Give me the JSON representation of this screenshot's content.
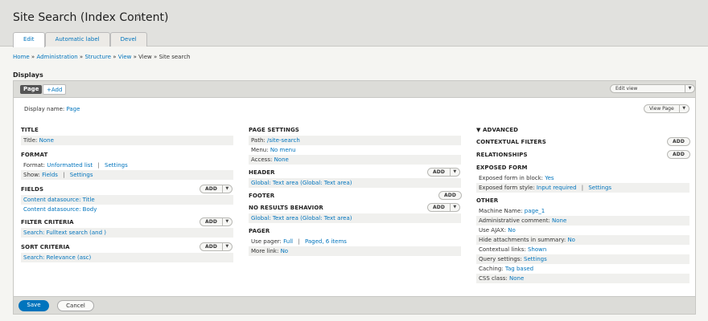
{
  "header": {
    "title": "Site Search (Index Content)",
    "star": "☆",
    "tabs": [
      "Edit",
      "Automatic label",
      "Devel"
    ]
  },
  "breadcrumb": {
    "home": "Home",
    "administration": "Administration",
    "structure": "Structure",
    "view": "View",
    "view_plain": "View",
    "current": "Site search",
    "sep": "»"
  },
  "displays": {
    "label": "Displays",
    "page_button": "Page",
    "add_button": "+Add",
    "edit_view_name": "Edit view name/description",
    "display_name_label": "Display name:",
    "display_name_value": "Page",
    "view_page": "View Page"
  },
  "col1": {
    "title_h": "TITLE",
    "title_label": "Title:",
    "title_value": "None",
    "format_h": "FORMAT",
    "format_label": "Format:",
    "format_value": "Unformatted list",
    "format_settings": "Settings",
    "show_label": "Show:",
    "show_value": "Fields",
    "show_settings": "Settings",
    "fields_h": "FIELDS",
    "fields": [
      "Content datasource: Title",
      "Content datasource: Body"
    ],
    "filter_h": "FILTER CRITERIA",
    "filter": "Search: Fulltext search (and )",
    "sort_h": "SORT CRITERIA",
    "sort": "Search: Relevance (asc)",
    "add": "Add"
  },
  "col2": {
    "page_settings_h": "PAGE SETTINGS",
    "path_label": "Path:",
    "path_value": "/site-search",
    "menu_label": "Menu:",
    "menu_value": "No menu",
    "access_label": "Access:",
    "access_value": "None",
    "header_h": "HEADER",
    "header_value": "Global: Text area (Global: Text area)",
    "footer_h": "FOOTER",
    "noresults_h": "NO RESULTS BEHAVIOR",
    "noresults_value": "Global: Text area (Global: Text area)",
    "pager_h": "PAGER",
    "use_pager_label": "Use pager:",
    "use_pager_value": "Full",
    "use_pager_paged": "Paged, 6 items",
    "more_link_label": "More link:",
    "more_link_value": "No",
    "add": "Add"
  },
  "col3": {
    "advanced_h": "▼ ADVANCED",
    "contextual_h": "CONTEXTUAL FILTERS",
    "relationships_h": "RELATIONSHIPS",
    "exposed_h": "EXPOSED FORM",
    "exposed_block_label": "Exposed form in block:",
    "exposed_block_value": "Yes",
    "exposed_style_label": "Exposed form style:",
    "exposed_style_value": "Input required",
    "exposed_style_settings": "Settings",
    "other_h": "OTHER",
    "machine_label": "Machine Name:",
    "machine_value": "page_1",
    "admin_comment_label": "Administrative comment:",
    "admin_comment_value": "None",
    "ajax_label": "Use AJAX:",
    "ajax_value": "No",
    "hide_label": "Hide attachments in summary:",
    "hide_value": "No",
    "contextual_links_label": "Contextual links:",
    "contextual_links_value": "Shown",
    "query_label": "Query settings:",
    "query_value": "Settings",
    "caching_label": "Caching:",
    "caching_value": "Tag based",
    "css_label": "CSS class:",
    "css_value": "None",
    "add": "Add"
  },
  "footer": {
    "save": "Save",
    "cancel": "Cancel"
  }
}
